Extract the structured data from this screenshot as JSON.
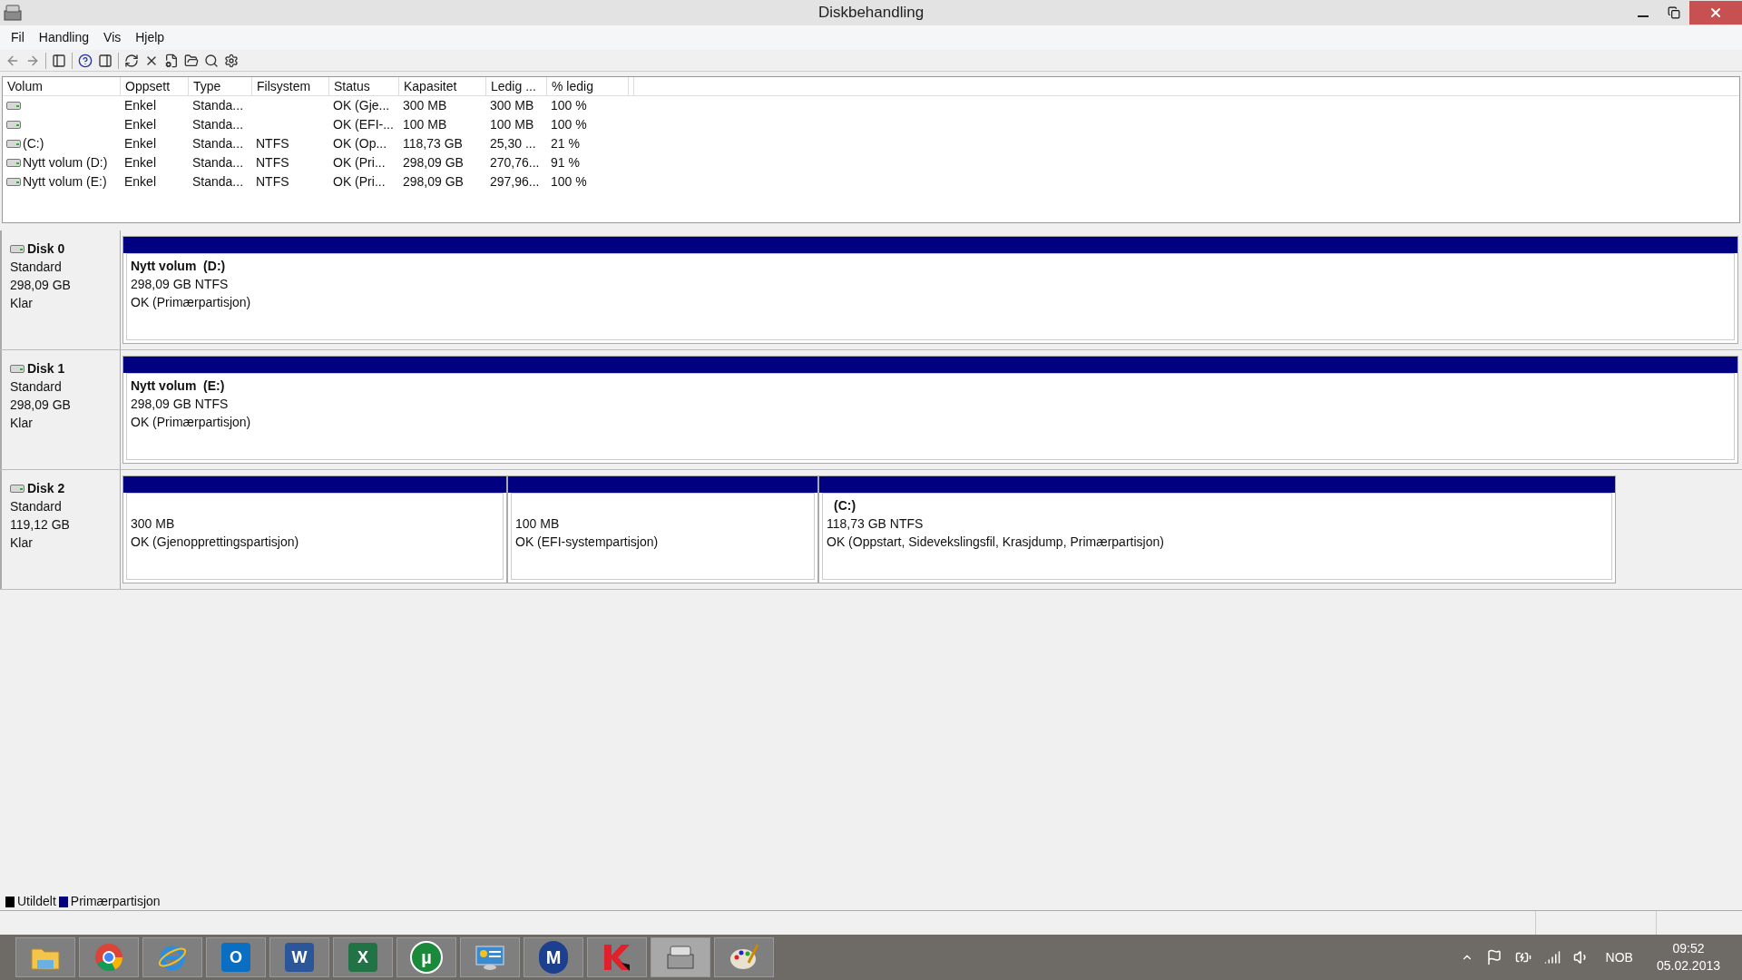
{
  "window": {
    "title": "Diskbehandling"
  },
  "menu": [
    "Fil",
    "Handling",
    "Vis",
    "Hjelp"
  ],
  "table": {
    "columns": [
      "Volum",
      "Oppsett",
      "Type",
      "Filsystem",
      "Status",
      "Kapasitet",
      "Ledig ...",
      "% ledig"
    ],
    "rows": [
      {
        "cells": [
          "",
          "Enkel",
          "Standa...",
          "",
          "OK (Gje...",
          "300 MB",
          "300 MB",
          "100 %"
        ]
      },
      {
        "cells": [
          "",
          "Enkel",
          "Standa...",
          "",
          "OK (EFI-...",
          "100 MB",
          "100 MB",
          "100 %"
        ]
      },
      {
        "cells": [
          "(C:)",
          "Enkel",
          "Standa...",
          "NTFS",
          "OK (Op...",
          "118,73 GB",
          "25,30 ...",
          "21 %"
        ]
      },
      {
        "cells": [
          "Nytt volum (D:)",
          "Enkel",
          "Standa...",
          "NTFS",
          "OK (Pri...",
          "298,09 GB",
          "270,76...",
          "91 %"
        ]
      },
      {
        "cells": [
          "Nytt volum (E:)",
          "Enkel",
          "Standa...",
          "NTFS",
          "OK (Pri...",
          "298,09 GB",
          "297,96...",
          "100 %"
        ]
      }
    ]
  },
  "disks": [
    {
      "name": "Disk 0",
      "type": "Standard",
      "size": "298,09 GB",
      "state": "Klar",
      "partitions": [
        {
          "color": "#000080",
          "title": "Nytt volum  (D:)",
          "size": "298,09 GB NTFS",
          "status": "OK (Primærpartisjon)"
        }
      ]
    },
    {
      "name": "Disk 1",
      "type": "Standard",
      "size": "298,09 GB",
      "state": "Klar",
      "partitions": [
        {
          "color": "#000080",
          "title": "Nytt volum  (E:)",
          "size": "298,09 GB NTFS",
          "status": "OK (Primærpartisjon)"
        }
      ]
    },
    {
      "name": "Disk 2",
      "type": "Standard",
      "size": "119,12 GB",
      "state": "Klar",
      "partitions": [
        {
          "color": "#000080",
          "size": "300 MB",
          "status": "OK (Gjenopprettingspartisjon)"
        },
        {
          "color": "#000080",
          "size": "100 MB",
          "status": "OK (EFI-systempartisjon)"
        },
        {
          "color": "#000080",
          "title": "(C:)",
          "size": "118,73 GB NTFS",
          "status": "OK (Oppstart, Sidevekslingsfil, Krasjdump, Primærpartisjon)"
        }
      ]
    }
  ],
  "legend": [
    {
      "label": "Utildelt",
      "color": "#000000"
    },
    {
      "label": "Primærpartisjon",
      "color": "#000080"
    }
  ],
  "taskbar": {
    "apps": [
      {
        "kind": "folder"
      },
      {
        "kind": "chrome"
      },
      {
        "kind": "ie"
      },
      {
        "kind": "outlook",
        "glyph": "O"
      },
      {
        "kind": "word",
        "glyph": "W"
      },
      {
        "kind": "excel",
        "glyph": "X"
      },
      {
        "kind": "torrent",
        "glyph": "µ"
      },
      {
        "kind": "panel"
      },
      {
        "kind": "m",
        "glyph": "M"
      },
      {
        "kind": "kaspersky"
      },
      {
        "kind": "disk"
      },
      {
        "kind": "paint"
      }
    ],
    "language": "NOB",
    "time": "09:52",
    "date": "05.02.2013"
  }
}
